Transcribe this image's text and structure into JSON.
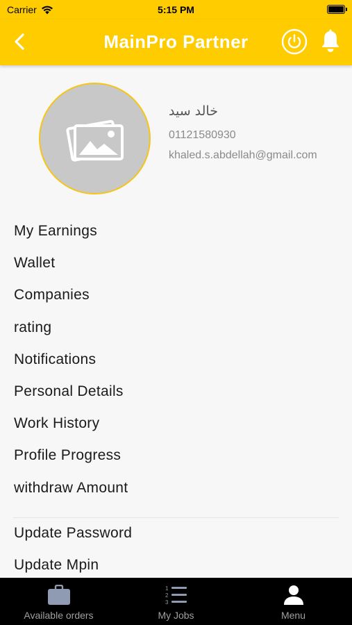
{
  "status_bar": {
    "carrier": "Carrier",
    "time": "5:15 PM"
  },
  "header": {
    "title": "MainPro Partner",
    "accent_color": "#ffcc00"
  },
  "profile": {
    "name": "خالد سيد",
    "phone": "01121580930",
    "email": "khaled.s.abdellah@gmail.com"
  },
  "menu": {
    "items": [
      {
        "label": "My Earnings"
      },
      {
        "label": "Wallet"
      },
      {
        "label": "Companies"
      },
      {
        "label": "rating"
      },
      {
        "label": "Notifications"
      },
      {
        "label": "Personal Details"
      },
      {
        "label": "Work History"
      },
      {
        "label": "Profile Progress"
      },
      {
        "label": "withdraw Amount"
      }
    ],
    "secondary_items": [
      {
        "label": "Update Password"
      },
      {
        "label": "Update Mpin"
      }
    ]
  },
  "tab_bar": {
    "tabs": [
      {
        "label": "Available orders",
        "icon": "briefcase-icon"
      },
      {
        "label": "My Jobs",
        "icon": "numbered-list-icon"
      },
      {
        "label": "Menu",
        "icon": "person-icon",
        "active": true
      }
    ]
  }
}
